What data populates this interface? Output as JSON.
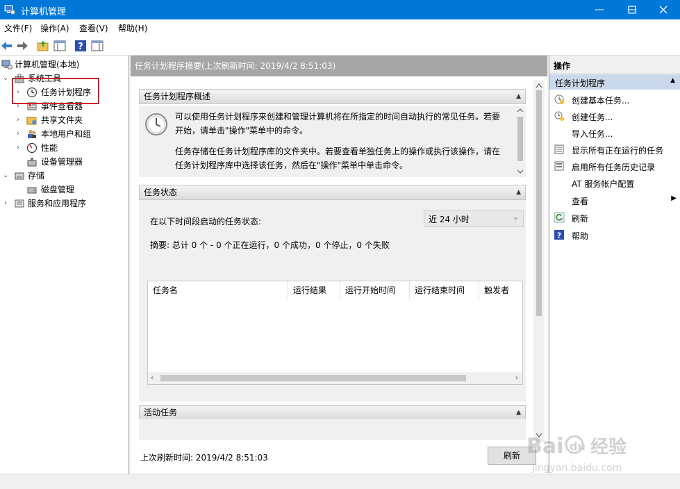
{
  "window": {
    "title": "计算机管理",
    "controls": [
      "minimize-icon",
      "maximize-icon",
      "close-icon"
    ]
  },
  "menu": {
    "items": [
      "文件(F)",
      "操作(A)",
      "查看(V)",
      "帮助(H)"
    ]
  },
  "toolbar": {
    "buttons": [
      "back-icon",
      "forward-icon",
      "folder-up-icon",
      "show-hide-tree-icon",
      "help-icon",
      "show-hide-action-pane-icon"
    ]
  },
  "tree": {
    "items": [
      {
        "label": "计算机管理(本地)",
        "icon": "computer-management-icon"
      },
      {
        "label": "系统工具",
        "icon": "tools-icon"
      },
      {
        "label": "任务计划程序",
        "icon": "clock-icon"
      },
      {
        "label": "事件查看器",
        "icon": "event-viewer-icon"
      },
      {
        "label": "共享文件夹",
        "icon": "shared-folder-icon"
      },
      {
        "label": "本地用户和组",
        "icon": "users-icon"
      },
      {
        "label": "性能",
        "icon": "performance-icon"
      },
      {
        "label": "设备管理器",
        "icon": "device-manager-icon"
      },
      {
        "label": "存储",
        "icon": "storage-icon"
      },
      {
        "label": "磁盘管理",
        "icon": "disk-icon"
      },
      {
        "label": "服务和应用程序",
        "icon": "services-icon"
      }
    ]
  },
  "center": {
    "header": "任务计划程序摘要(上次刷新时间: 2019/4/2 8:51:03)",
    "overview": {
      "title": "任务计划程序概述",
      "para1_line1": "可以使用任务计划程序来创建和管理计算机将在所指定的时间自动执行的常见任务。若要",
      "para1_line2": "开始，请单击\"操作\"菜单中的命令。",
      "para2_line1": "任务存储在任务计划程序库的文件夹中。若要查看单独任务上的操作或执行该操作，请在",
      "para2_line2": "任务计划程序库中选择该任务，然后在\"操作\"菜单中单击命令。"
    },
    "status": {
      "title": "任务状态",
      "period_label": "在以下时间段启动的任务状态:",
      "period_value": "近 24 小时",
      "summary": "摘要: 总计 0 个 - 0 个正在运行，0 个成功，0 个停止，0 个失败",
      "columns": [
        "任务名",
        "运行结果",
        "运行开始时间",
        "运行结束时间",
        "触发者"
      ]
    },
    "active": {
      "title": "活动任务"
    },
    "last_refresh": "上次刷新时间: 2019/4/2 8:51:03",
    "refresh_button": "刷新"
  },
  "actions": {
    "title": "操作",
    "group": "任务计划程序",
    "items": [
      {
        "label": "创建基本任务...",
        "icon": "create-basic-task-icon"
      },
      {
        "label": "创建任务...",
        "icon": "create-task-icon"
      },
      {
        "label": "导入任务...",
        "icon": ""
      },
      {
        "label": "显示所有正在运行的任务",
        "icon": "running-tasks-icon"
      },
      {
        "label": "启用所有任务历史记录",
        "icon": "history-icon"
      },
      {
        "label": "AT 服务帐户配置",
        "icon": ""
      },
      {
        "label": "查看",
        "icon": ""
      },
      {
        "label": "刷新",
        "icon": "refresh-icon"
      },
      {
        "label": "帮助",
        "icon": "help-icon"
      }
    ]
  },
  "watermark": {
    "line1": "Bai 经验",
    "line2": "jingyan.baidu.com"
  },
  "colors": {
    "titlebar": "#0078d7",
    "highlight_border": "#d0202a",
    "action_group": "#c9d8ea",
    "center_header": "#a6a6a6"
  }
}
